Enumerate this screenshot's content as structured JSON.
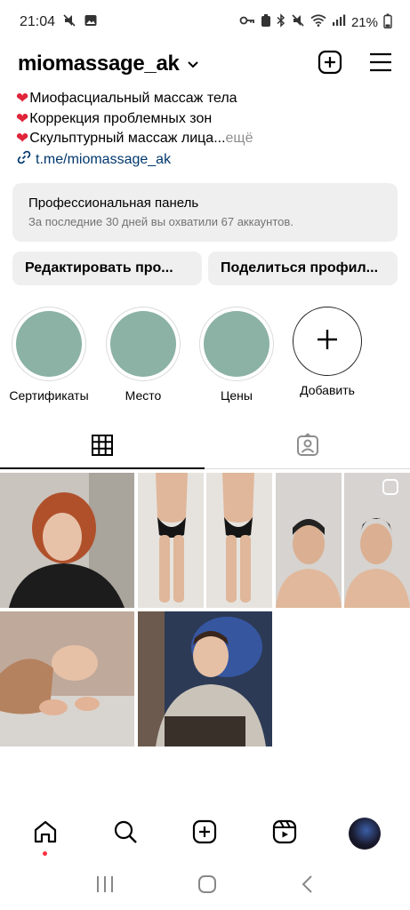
{
  "status": {
    "time": "21:04",
    "battery": "21%"
  },
  "header": {
    "username": "miomassage_ak"
  },
  "bio": {
    "lines": [
      "Миофасциальный массаж тела",
      "Коррекция проблемных зон",
      "Скульптурный массаж лица..."
    ],
    "more": " ещё",
    "link": "t.me/miomassage_ak"
  },
  "pro_panel": {
    "title": "Профессиональная панель",
    "subtitle": "За последние 30 дней вы охватили 67 аккаунтов."
  },
  "buttons": {
    "edit": "Редактировать про...",
    "share": "Поделиться профил..."
  },
  "highlights": [
    {
      "label": "Сертификаты"
    },
    {
      "label": "Место"
    },
    {
      "label": "Цены"
    },
    {
      "label": "Добавить"
    }
  ],
  "colors": {
    "highlight_fill": "#8bb2a4",
    "link": "#00376b",
    "heart": "#e0243a",
    "notification_dot": "#ff3040"
  },
  "icons": {
    "new_post": "plus-square-icon",
    "menu": "hamburger-icon",
    "grid_tab": "grid-icon",
    "tagged_tab": "tagged-person-icon",
    "nav": [
      "home-icon",
      "search-icon",
      "create-icon",
      "reels-icon",
      "profile-avatar"
    ]
  }
}
